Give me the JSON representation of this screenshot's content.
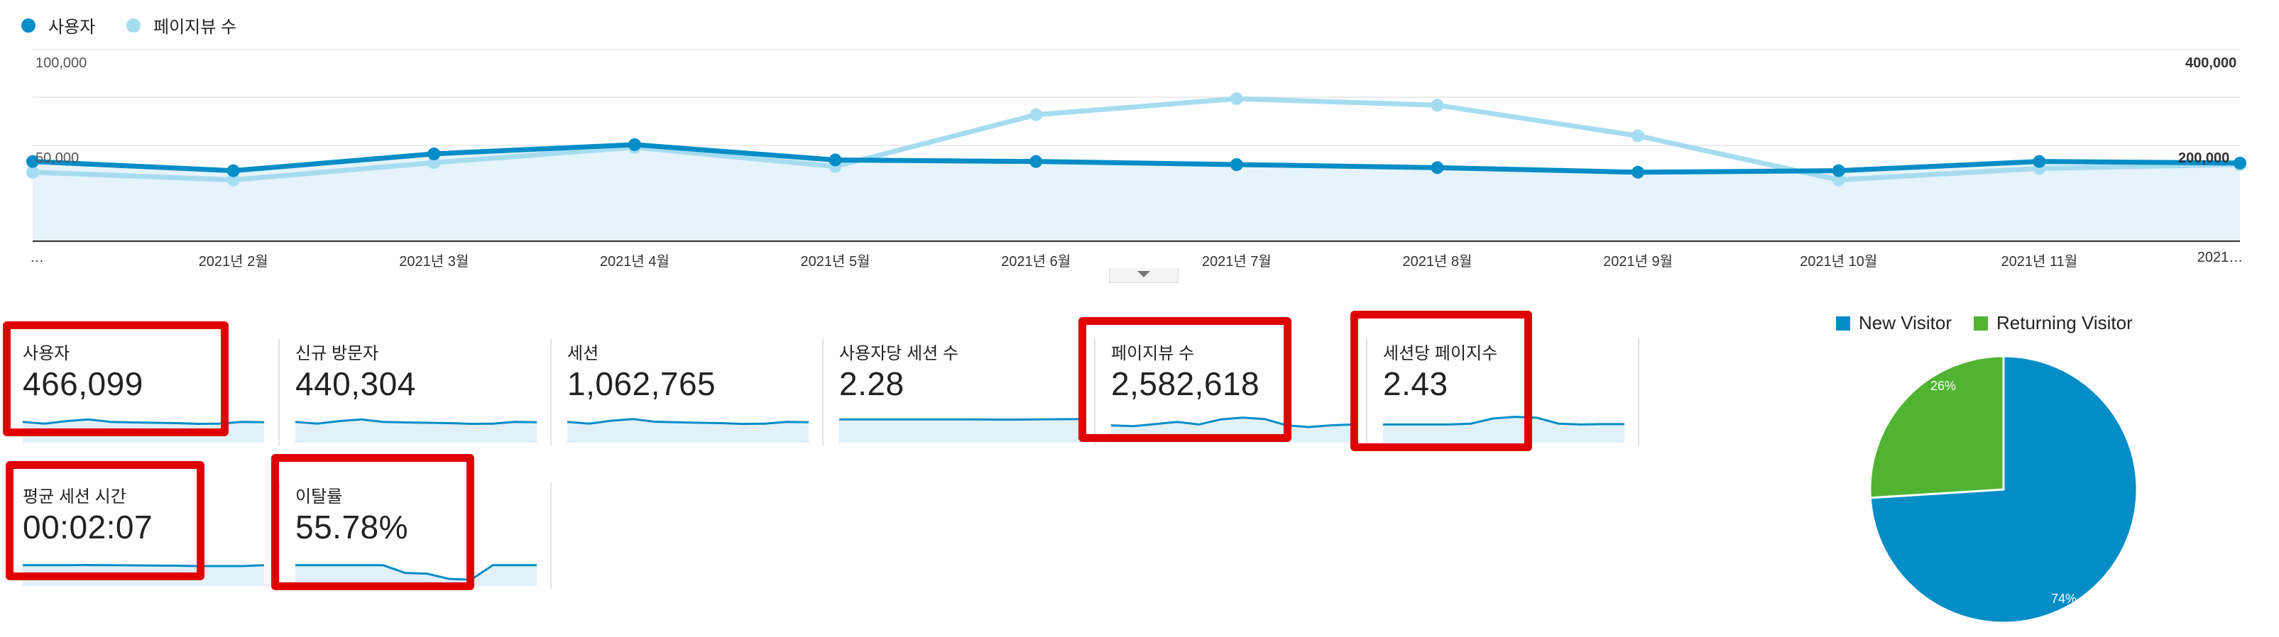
{
  "legend": {
    "users": {
      "label": "사용자",
      "color": "#058dc7"
    },
    "pageviews": {
      "label": "페이지뷰 수",
      "color": "#a6dcf0"
    }
  },
  "chart_data": [
    {
      "type": "line",
      "categories": [
        "…",
        "2021년 2월",
        "2021년 3월",
        "2021년 4월",
        "2021년 5월",
        "2021년 6월",
        "2021년 7월",
        "2021년 8월",
        "2021년 9월",
        "2021년 10월",
        "2021년 11월",
        "2021…"
      ],
      "series": [
        {
          "name": "사용자",
          "axis": "left",
          "values": [
            52000,
            46000,
            57000,
            63000,
            53000,
            52000,
            50000,
            48000,
            45000,
            46000,
            52000,
            51000
          ]
        },
        {
          "name": "페이지뷰 수",
          "axis": "right",
          "values": [
            180000,
            160000,
            205000,
            245000,
            195000,
            330000,
            372000,
            355000,
            275000,
            160000,
            190000,
            200000
          ]
        }
      ],
      "left_axis": {
        "ticks": [
          "100,000",
          "50,000"
        ],
        "ylim": [
          0,
          125000
        ]
      },
      "right_axis": {
        "ticks": [
          "400,000",
          "200,000"
        ],
        "ylim": [
          0,
          500000
        ]
      },
      "area_fill": true
    },
    {
      "type": "pie",
      "labels": [
        "New Visitor",
        "Returning Visitor"
      ],
      "values": [
        74,
        26
      ],
      "value_labels": [
        "74%",
        "26%"
      ],
      "colors": [
        "#058dc7",
        "#50b432"
      ]
    }
  ],
  "metrics": [
    {
      "label": "사용자",
      "value": "466,099",
      "highlighted": true,
      "spark": [
        0.55,
        0.45,
        0.6,
        0.7,
        0.55,
        0.52,
        0.5,
        0.48,
        0.44,
        0.45,
        0.55,
        0.53
      ]
    },
    {
      "label": "신규 방문자",
      "value": "440,304",
      "highlighted": false,
      "spark": [
        0.55,
        0.45,
        0.6,
        0.7,
        0.55,
        0.52,
        0.5,
        0.48,
        0.44,
        0.45,
        0.55,
        0.53
      ]
    },
    {
      "label": "세션",
      "value": "1,062,765",
      "highlighted": false,
      "spark": [
        0.55,
        0.45,
        0.62,
        0.72,
        0.56,
        0.53,
        0.5,
        0.48,
        0.43,
        0.45,
        0.55,
        0.53
      ]
    },
    {
      "label": "사용자당 세션 수",
      "value": "2.28",
      "highlighted": false,
      "spark": [
        0.7,
        0.7,
        0.7,
        0.7,
        0.7,
        0.7,
        0.7,
        0.69,
        0.69,
        0.7,
        0.71,
        0.72
      ]
    },
    {
      "label": "페이지뷰 수",
      "value": "2,582,618",
      "highlighted": true,
      "spark": [
        0.35,
        0.3,
        0.42,
        0.55,
        0.4,
        0.7,
        0.8,
        0.72,
        0.35,
        0.25,
        0.35,
        0.4
      ]
    },
    {
      "label": "세션당 페이지수",
      "value": "2.43",
      "highlighted": true,
      "spark": [
        0.4,
        0.4,
        0.4,
        0.4,
        0.45,
        0.75,
        0.85,
        0.8,
        0.45,
        0.4,
        0.42,
        0.42
      ]
    },
    {
      "label": "평균 세션 시간",
      "value": "00:02:07",
      "highlighted": true,
      "spark": [
        0.55,
        0.55,
        0.55,
        0.56,
        0.55,
        0.54,
        0.53,
        0.52,
        0.5,
        0.5,
        0.5,
        0.55
      ]
    },
    {
      "label": "이탈률",
      "value": "55.78%",
      "highlighted": true,
      "spark": [
        0.55,
        0.55,
        0.55,
        0.55,
        0.55,
        0.1,
        0.05,
        -0.25,
        -0.3,
        0.55,
        0.55,
        0.55
      ]
    }
  ]
}
